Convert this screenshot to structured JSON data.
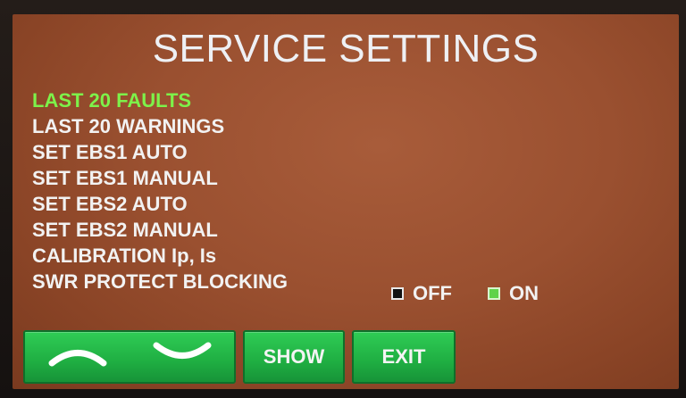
{
  "screen": {
    "title": "SERVICE SETTINGS"
  },
  "menu": {
    "items": [
      {
        "label": "LAST 20 FAULTS",
        "active": true
      },
      {
        "label": "LAST 20 WARNINGS",
        "active": false
      },
      {
        "label": "SET EBS1 AUTO",
        "active": false
      },
      {
        "label": "SET EBS1 MANUAL",
        "active": false
      },
      {
        "label": "SET EBS2 AUTO",
        "active": false
      },
      {
        "label": "SET EBS2 MANUAL",
        "active": false
      },
      {
        "label": "CALIBRATION Ip, Is",
        "active": false
      },
      {
        "label": "SWR PROTECT BLOCKING",
        "active": false
      }
    ]
  },
  "swr_toggle": {
    "off_label": "OFF",
    "on_label": "ON",
    "selected": "ON"
  },
  "buttons": {
    "show_label": "SHOW",
    "exit_label": "EXIT"
  },
  "icons": {
    "up": "chevron-up-icon",
    "down": "chevron-down-icon"
  },
  "colors": {
    "active_item": "#7df24a",
    "button_green": "#1fae42",
    "screen_bg": "#9a5030"
  }
}
